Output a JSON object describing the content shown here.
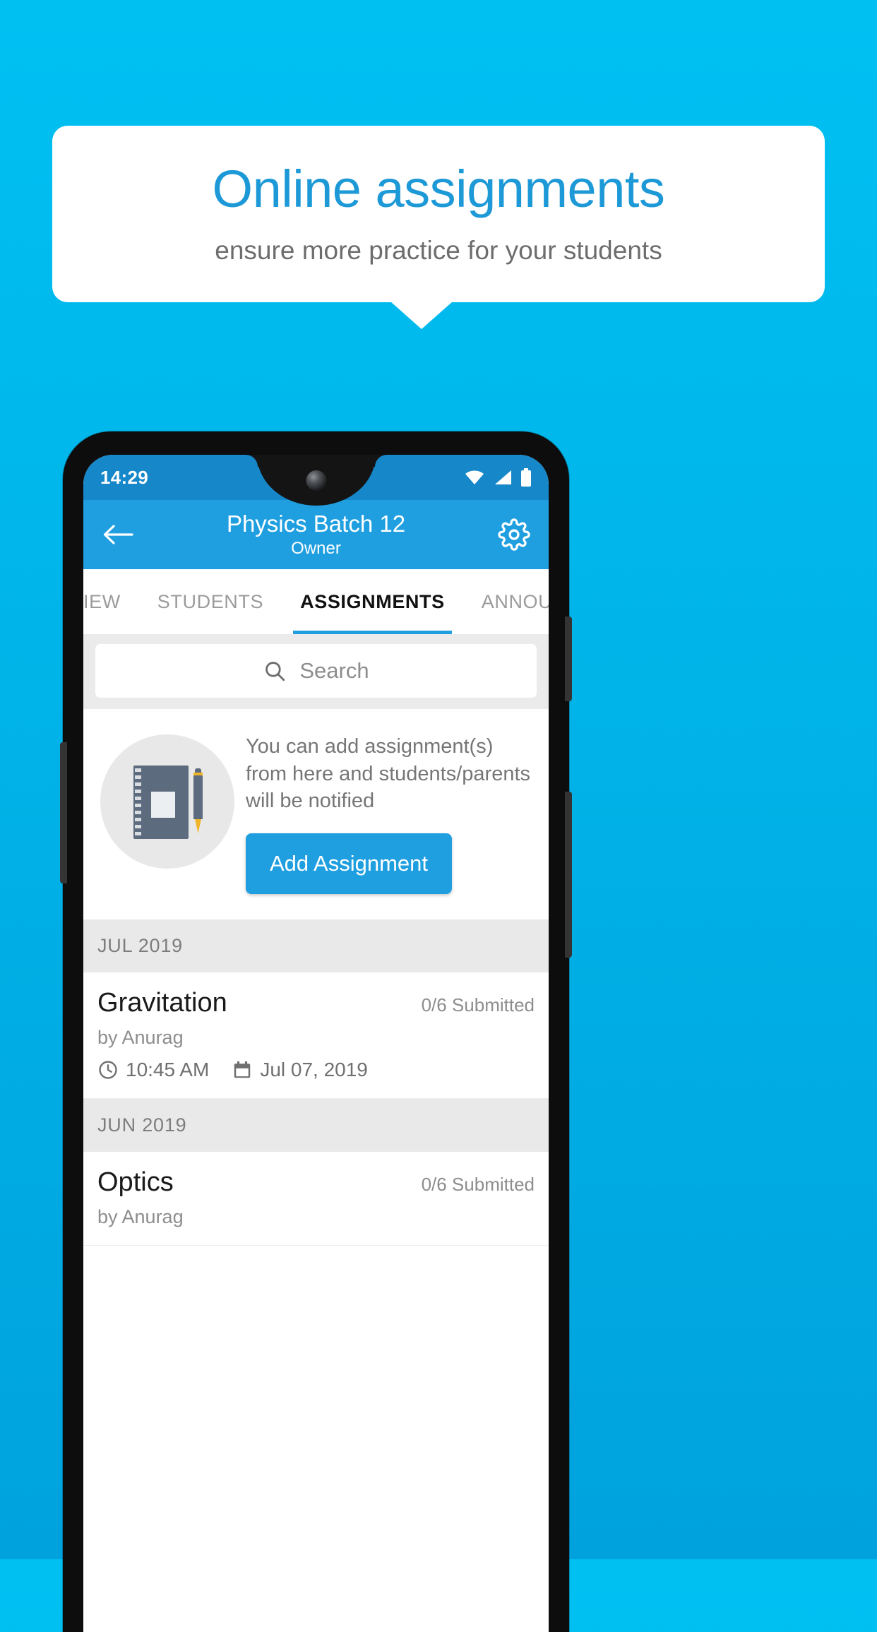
{
  "promo": {
    "title": "Online assignments",
    "subtitle": "ensure more practice for your students"
  },
  "colors": {
    "background_top": "#00c0f2",
    "background_bottom": "#00a2dd",
    "accent": "#1f9fe0",
    "statusbar": "#1687c9",
    "promo_title": "#1c99d6"
  },
  "phone": {
    "statusbar": {
      "time": "14:29",
      "icons": [
        "wifi-icon",
        "signal-icon",
        "battery-icon"
      ]
    },
    "appbar": {
      "back_icon": "back-arrow-icon",
      "title": "Physics Batch 12",
      "subtitle": "Owner",
      "settings_icon": "gear-icon"
    },
    "tabs": [
      {
        "label": "IEW",
        "active": false
      },
      {
        "label": "STUDENTS",
        "active": false
      },
      {
        "label": "ASSIGNMENTS",
        "active": true
      },
      {
        "label": "ANNOUNCEM",
        "active": false
      }
    ],
    "search": {
      "icon": "search-icon",
      "placeholder": "Search",
      "value": ""
    },
    "empty_state": {
      "illustration": "notebook-and-pen-icon",
      "message": "You can add assignment(s) from here and students/parents will be notified",
      "button_label": "Add Assignment"
    },
    "groups": [
      {
        "month_label": "JUL 2019",
        "assignments": [
          {
            "title": "Gravitation",
            "status": "0/6 Submitted",
            "author": "by Anurag",
            "time": "10:45 AM",
            "date": "Jul 07, 2019",
            "time_icon": "clock-icon",
            "date_icon": "calendar-icon"
          }
        ]
      },
      {
        "month_label": "JUN 2019",
        "assignments": [
          {
            "title": "Optics",
            "status": "0/6 Submitted",
            "author": "by Anurag",
            "time": "",
            "date": "",
            "time_icon": "clock-icon",
            "date_icon": "calendar-icon"
          }
        ]
      }
    ]
  }
}
